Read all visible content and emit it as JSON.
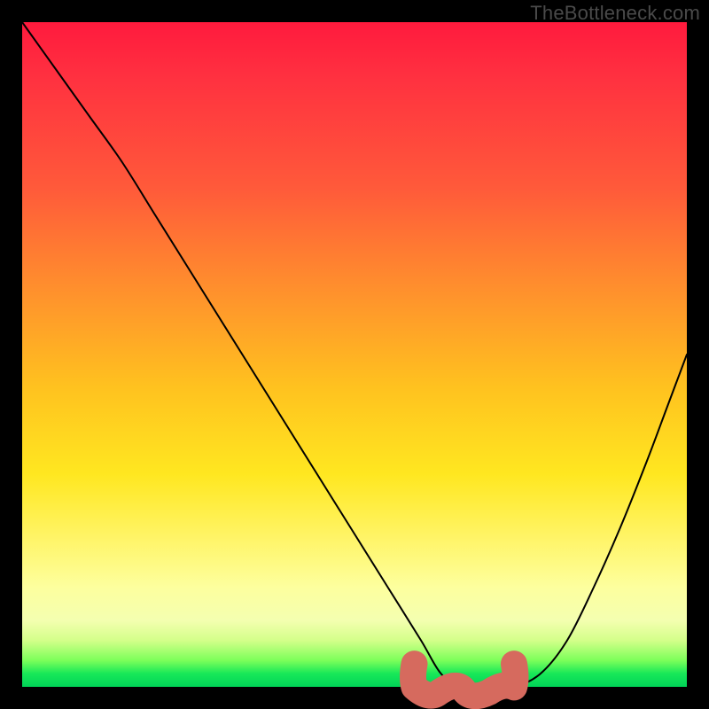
{
  "watermark": "TheBottleneck.com",
  "chart_data": {
    "type": "line",
    "title": "",
    "xlabel": "",
    "ylabel": "",
    "xlim": [
      0,
      100
    ],
    "ylim": [
      0,
      100
    ],
    "grid": false,
    "legend": false,
    "series": [
      {
        "name": "bottleneck-curve",
        "x": [
          0,
          5,
          10,
          15,
          20,
          25,
          30,
          35,
          40,
          45,
          50,
          55,
          60,
          63,
          66,
          70,
          74,
          78,
          82,
          86,
          90,
          94,
          97,
          100
        ],
        "y": [
          100,
          93,
          86,
          79,
          71,
          63,
          55,
          47,
          39,
          31,
          23,
          15,
          7,
          2,
          0,
          0,
          0,
          2,
          7,
          15,
          24,
          34,
          42,
          50
        ],
        "color": "#000000",
        "stroke_width": 2
      }
    ],
    "marker": {
      "name": "optimal-range",
      "shape": "rounded-bar",
      "x_start": 59,
      "x_end": 74,
      "y": 1.2,
      "color": "#d66a5e",
      "thickness": 2.5
    },
    "background_gradient": {
      "top": "#ff1a3d",
      "mid_upper": "#ff8f2d",
      "mid": "#ffe720",
      "mid_lower": "#fdff9e",
      "bottom": "#00d357"
    }
  }
}
